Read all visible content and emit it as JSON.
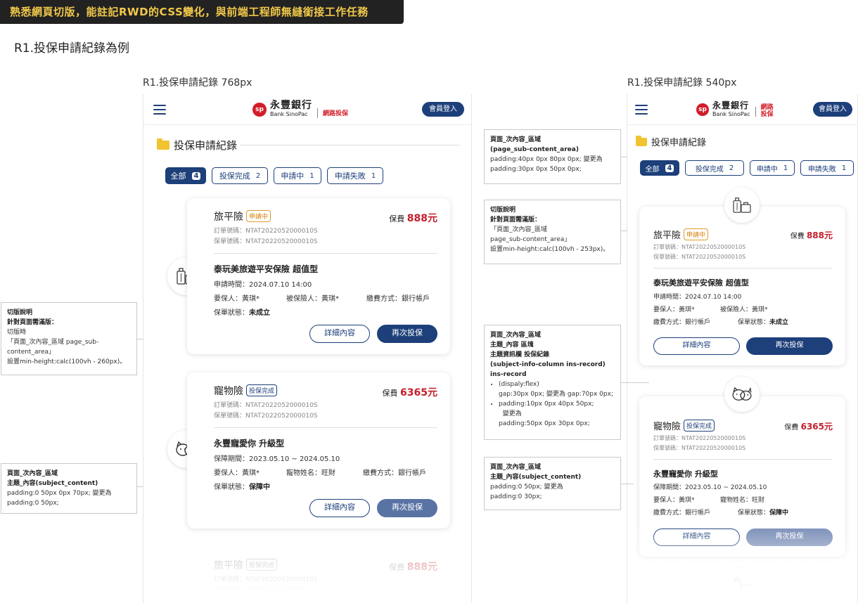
{
  "banner": "熟悉網頁切版，能註記RWD的CSS變化，與前端工程師無縫銜接工作任務",
  "page_title": "R1.投保申請紀錄為例",
  "frames": {
    "f768_label": "R1.投保申請紀錄 768px",
    "f540_label": "R1.投保申請紀錄 540px"
  },
  "header": {
    "bank_zh": "永豐銀行",
    "bank_en": "Bank SinoPac",
    "web_insurance": "網路投保",
    "login": "會員登入"
  },
  "section_title": "投保申請紀錄",
  "tabs": [
    {
      "label": "全部",
      "count": "4",
      "active": true
    },
    {
      "label": "投保完成",
      "count": "2",
      "active": false
    },
    {
      "label": "申請中",
      "count": "1",
      "active": false
    },
    {
      "label": "申請失敗",
      "count": "1",
      "active": false
    }
  ],
  "cards": [
    {
      "type": "旅平險",
      "status": "申請中",
      "status_color": "orange",
      "premium_label": "保費",
      "premium": "888元",
      "order_no": "訂單號碼：NTAT2022052000010S",
      "policy_no": "保單號碼：NTAT2022052000010S",
      "product": "泰玩美旅遊平安保險 超值型",
      "time": "申請時間：2024.07.10 14:00",
      "applicant": "要保人：黃琪*",
      "insured": "被保險人：黃琪*",
      "payment": "繳費方式：銀行帳戶",
      "status_label": "保單狀態：",
      "status_value": "未成立",
      "btn_detail": "詳細內容",
      "btn_again": "再次投保",
      "icon": "luggage-icon"
    },
    {
      "type": "寵物險",
      "status": "投保完成",
      "status_color": "blue",
      "premium_label": "保費",
      "premium": "6365元",
      "order_no": "訂單號碼：NTAT2022052000010S",
      "policy_no": "保單號碼：NTAT2022052000010S",
      "product": "永豐寵愛你 升級型",
      "time": "保障期間：2023.05.10 ~ 2024.05.10",
      "applicant": "要保人：黃琪*",
      "insured": "寵物姓名：旺財",
      "payment": "繳費方式：銀行帳戶",
      "status_label": "保單狀態：",
      "status_value": "保障中",
      "btn_detail": "詳細內容",
      "btn_again": "再次投保",
      "icon": "pet-icon"
    },
    {
      "type": "旅平險",
      "status": "投保完成",
      "status_color": "grey",
      "premium_label": "保費",
      "premium": "888元",
      "order_no": "訂單號碼：NTAT2022052000010S",
      "policy_no": "保單號碼：NTAT2022052000010S"
    }
  ],
  "notes_left": [
    {
      "line1": "切版說明",
      "line2": "針對頁面需滿版：",
      "line3": "切版時",
      "line4": "「頁面_次內容_區域 page_sub-",
      "line5": "content_area」",
      "line6": "設置min-height:calc(100vh - 260px)。"
    },
    {
      "line1": "頁面_次內容_區域",
      "line2": "主題_內容(subject_content)",
      "line3": "padding:0 50px 0px 70px; 變更為",
      "line4": "padding:0 50px;"
    }
  ],
  "notes_right": [
    {
      "line1": "頁面_次內容_區域",
      "line2": "(page_sub-content_area)",
      "line3": "padding:40px 0px 80px 0px; 變更為",
      "line4": "padding:30px 0px 50px 0px;"
    },
    {
      "line1": "切版說明",
      "line2": "針對頁面需滿版：",
      "line3": "「頁面_次內容_區域",
      "line4": " page_sub-content_area」",
      "line5": "設置min-height:calc(100vh - 253px)。"
    },
    {
      "line1": "頁面_次內容_區域",
      "line2": "主題_內容 區塊",
      "line3": "主題資訊欄 投保紀錄",
      "line4": "(subject-info-column ins-record)",
      "line5": "ins-record",
      "li1a": "(dispaly:flex)",
      "li1b": "gap:30px 0px; 變更為 gap:70px 0px;",
      "li2a": "padding:10px 0px 40px 50px;",
      "li2b": "變更為",
      "li2c": "padding:50px 0px 30px 0px;"
    },
    {
      "line1": "頁面_次內容_區域",
      "line2": "主題_內容(subject_content)",
      "line3": "padding:0 50px; 變更為",
      "line4": "padding:0 30px;"
    }
  ],
  "colors": {
    "navy": "#1d3f7a",
    "price_red": "#c41d2a",
    "status_orange": "#e09a2a",
    "banner_bg": "#222222",
    "banner_text": "#f0c84a",
    "folder": "#f2c330"
  }
}
